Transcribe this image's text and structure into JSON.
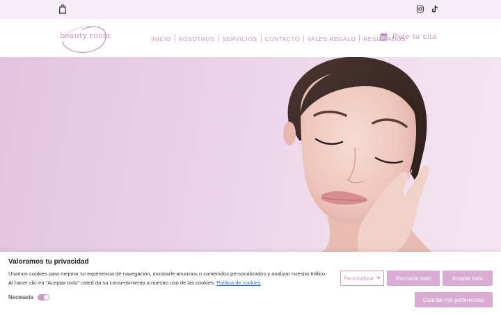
{
  "topbar": {
    "cart_icon": "shopping-bag-icon",
    "social": [
      {
        "icon": "instagram-icon"
      },
      {
        "icon": "tiktok-icon"
      }
    ]
  },
  "header": {
    "logo_text": "beauty room",
    "nav": [
      {
        "label": "INICIO"
      },
      {
        "label": "NOSOTROS"
      },
      {
        "label": "SERVICIOS"
      },
      {
        "label": "CONTACTO"
      },
      {
        "label": "VALES REGALO"
      },
      {
        "label": "RESULTADOS"
      }
    ],
    "cta": {
      "icon": "calendar-icon",
      "label": "Pide tu cita"
    }
  },
  "colors": {
    "accent": "#c79ac3",
    "button": "#d9abd5",
    "topbar_bg": "#f7edf6",
    "hero_bg": "#e8cde5"
  },
  "cookie": {
    "title": "Valoramos tu privacidad",
    "text": "Usamos cookies para mejorar su experiencia de navegación, mostrarle anuncios o contenidos personalizados y analizar nuestro tráfico. Al hacer clic en \"Aceptar todo\" usted da su consentimiento a nuestro uso de las cookies.",
    "link": "Política de cookies",
    "necesaria_label": "Necesaria",
    "buttons": {
      "personalizar": "Personalizar",
      "rechazar": "Rechazar todo",
      "aceptar": "Aceptar todo",
      "guardar": "Guardar mis preferencias"
    }
  }
}
